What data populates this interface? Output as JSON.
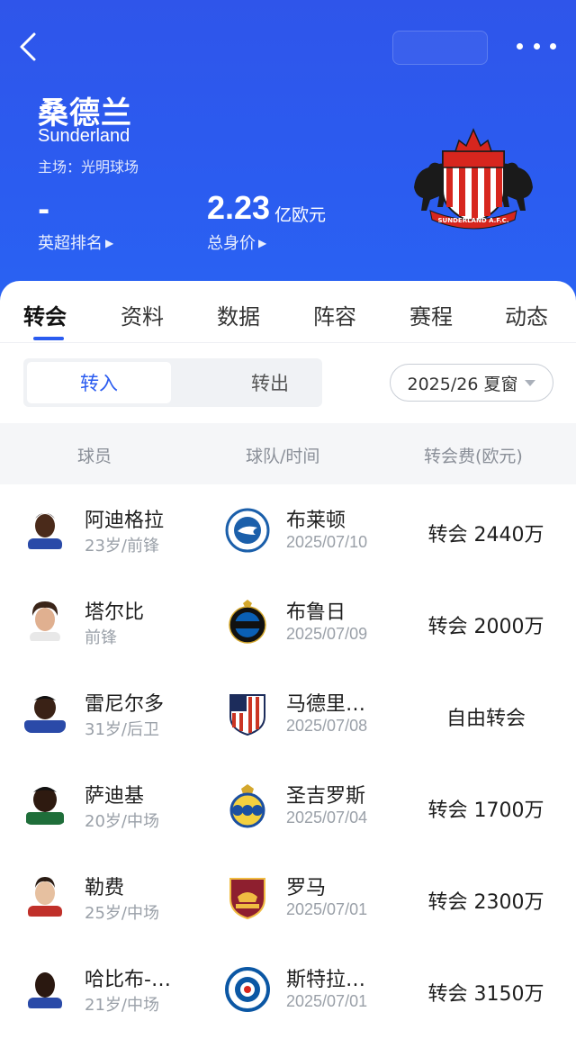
{
  "header": {
    "team_name_cn": "桑德兰",
    "team_name_en": "Sunderland",
    "stadium": "主场：光明球场",
    "rank_value": "-",
    "rank_label": "英超排名",
    "value_number": "2.23",
    "value_unit": "亿欧元",
    "value_label": "总身价",
    "crest_text": "SUNDERLAND A.F.C."
  },
  "tabs": [
    "转会",
    "资料",
    "数据",
    "阵容",
    "赛程",
    "动态"
  ],
  "segment": {
    "in_label": "转入",
    "out_label": "转出"
  },
  "window_select": {
    "value": "2025/26 夏窗"
  },
  "table_header": {
    "player": "球员",
    "team_time": "球队/时间",
    "fee": "转会费(欧元)"
  },
  "transfers": [
    {
      "player": "阿迪格拉",
      "meta": "23岁/前锋",
      "club": "布莱顿",
      "date": "2025/07/10",
      "fee": "转会 2440万"
    },
    {
      "player": "塔尔比",
      "meta": "前锋",
      "club": "布鲁日",
      "date": "2025/07/09",
      "fee": "转会 2000万"
    },
    {
      "player": "雷尼尔多",
      "meta": "31岁/后卫",
      "club": "马德里…",
      "date": "2025/07/08",
      "fee": "自由转会"
    },
    {
      "player": "萨迪基",
      "meta": "20岁/中场",
      "club": "圣吉罗斯",
      "date": "2025/07/04",
      "fee": "转会 1700万"
    },
    {
      "player": "勒费",
      "meta": "25岁/中场",
      "club": "罗马",
      "date": "2025/07/01",
      "fee": "转会 2300万"
    },
    {
      "player": "哈比布-…",
      "meta": "21岁/中场",
      "club": "斯特拉…",
      "date": "2025/07/01",
      "fee": "转会 3150万"
    }
  ],
  "colors": {
    "brand_blue": "#2b5cf0",
    "sunderland_red": "#d7261e"
  }
}
